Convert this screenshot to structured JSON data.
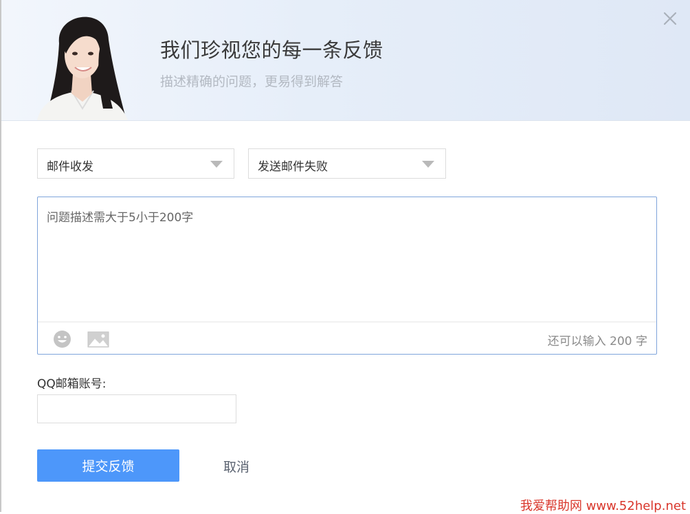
{
  "header": {
    "title": "我们珍视您的每一条反馈",
    "subtitle": "描述精确的问题，更易得到解答"
  },
  "form": {
    "category_select": {
      "value": "邮件收发"
    },
    "subcategory_select": {
      "value": "发送邮件失败"
    },
    "description": {
      "placeholder": "问题描述需大于5小于200字",
      "counter_text": "还可以输入 200 字"
    },
    "email": {
      "label": "QQ邮箱账号:",
      "value": ""
    },
    "submit_label": "提交反馈",
    "cancel_label": "取消"
  },
  "icons": [
    "close-icon",
    "emoji-icon",
    "image-icon",
    "dropdown-caret-icon"
  ],
  "colors": {
    "primary": "#4d97fa",
    "focus_border": "#7ea4db",
    "header_bg": "#e6eef9",
    "watermark": "#d9362b"
  },
  "watermark": "我爱帮助网 www.52help.net"
}
